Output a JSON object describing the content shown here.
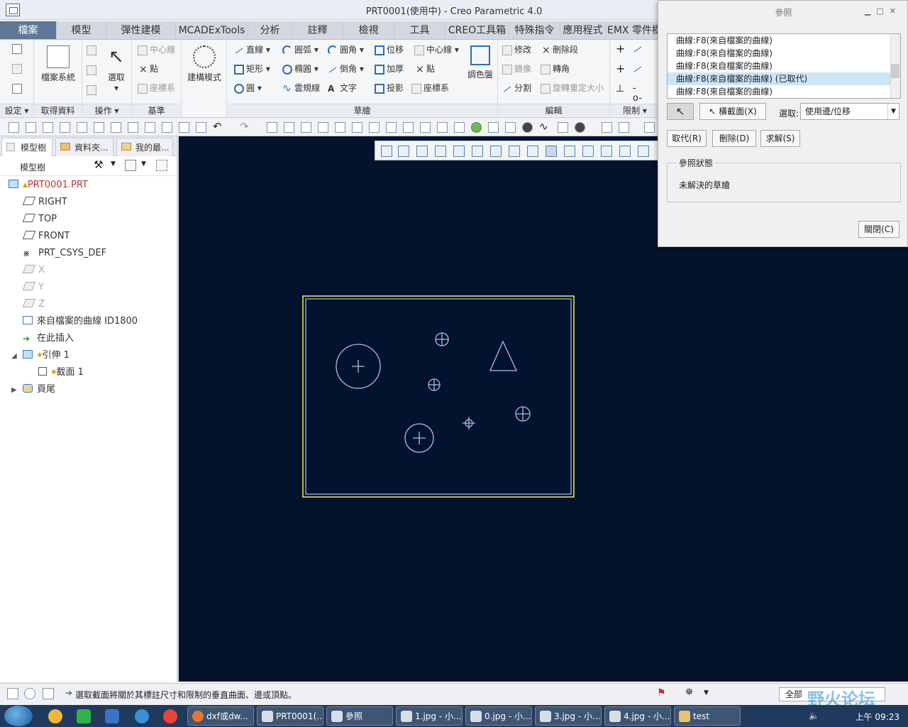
{
  "window": {
    "title": "PRT0001(使用中) - Creo Parametric 4.0"
  },
  "ribbon_tabs": [
    "檔案",
    "模型",
    "彈性建模",
    "MCADExTools",
    "分析",
    "註釋",
    "檢視",
    "工具",
    "CREO工具箱",
    "特殊指令",
    "應用程式",
    "EMX 零件樹"
  ],
  "ribbon": {
    "settings_group": "設定",
    "get_data": {
      "file_system": "檔案系統",
      "label": "取得資料"
    },
    "operations": {
      "select": "選取",
      "label": "操作"
    },
    "datum": {
      "centerline": "中心線",
      "point": "點",
      "csys": "座標系",
      "label": "基準"
    },
    "construction_mode": "建構模式",
    "sketch": {
      "line": "直線",
      "arc": "圓弧",
      "fillet": "圓角",
      "offset": "位移",
      "rectangle": "矩形",
      "ellipse": "橢圓",
      "chamfer": "倒角",
      "thicken": "加厚",
      "circle": "圓",
      "spline": "雲規線",
      "text": "文字",
      "project": "投影",
      "centerline": "中心線",
      "point": "點",
      "csys": "座標系",
      "palette": "調色盤",
      "label": "草繪"
    },
    "edit": {
      "modify": "修改",
      "delete_segment": "刪除段",
      "mirror": "鏡像",
      "corner": "轉角",
      "divide": "分割",
      "rotate_resize": "旋轉重定大小",
      "label": "編輯"
    },
    "constrain": {
      "label": "限制"
    }
  },
  "nav_tabs": [
    "模型樹",
    "資料夾...",
    "我的最..."
  ],
  "model_tree": {
    "header": "模型樹",
    "items": [
      {
        "label": "PRT0001.PRT"
      },
      {
        "label": "RIGHT"
      },
      {
        "label": "TOP"
      },
      {
        "label": "FRONT"
      },
      {
        "label": "PRT_CSYS_DEF"
      },
      {
        "label": "X"
      },
      {
        "label": "Y"
      },
      {
        "label": "Z"
      },
      {
        "label": "來自檔案的曲線 ID1800"
      },
      {
        "label": "在此插入"
      },
      {
        "label": "引伸 1"
      },
      {
        "label": "截面 1"
      },
      {
        "label": "頁尾"
      }
    ]
  },
  "ref_dialog": {
    "title": "參照",
    "items": [
      "曲線:F8(來自檔案的曲線)",
      "曲線:F8(來自檔案的曲線)",
      "曲線:F8(來自檔案的曲線)",
      "曲線:F8(來自檔案的曲線) (已取代)",
      "曲線:F8(來自檔案的曲線)"
    ],
    "xsec_button": "橫截面(X)",
    "select_label": "選取:",
    "select_value": "使用邊/位移",
    "replace_button": "取代(R)",
    "delete_button": "刪除(D)",
    "solve_button": "求解(S)",
    "status_legend": "參照狀態",
    "status_value": "未解決的草繪",
    "close_button": "關閉(C)"
  },
  "status_bar": {
    "message": "選取截面將關於其標註尺寸和限制的垂直曲面、邊或頂點。",
    "filter": "全部"
  },
  "watermark": "野火论坛",
  "taskbar": {
    "tasks": [
      "dxf或dw...",
      "PRT0001(...",
      "參照",
      "1.jpg - 小...",
      "0.jpg - 小...",
      "3.jpg - 小...",
      "4.jpg - 小...",
      "test"
    ],
    "clock": "上午 09:23"
  },
  "colors": {
    "graphics_bg": "#04122d",
    "sketch_entity": "#9fc6e8",
    "selection_highlight": "#f2f25a",
    "file_tab": "#5f7897"
  }
}
